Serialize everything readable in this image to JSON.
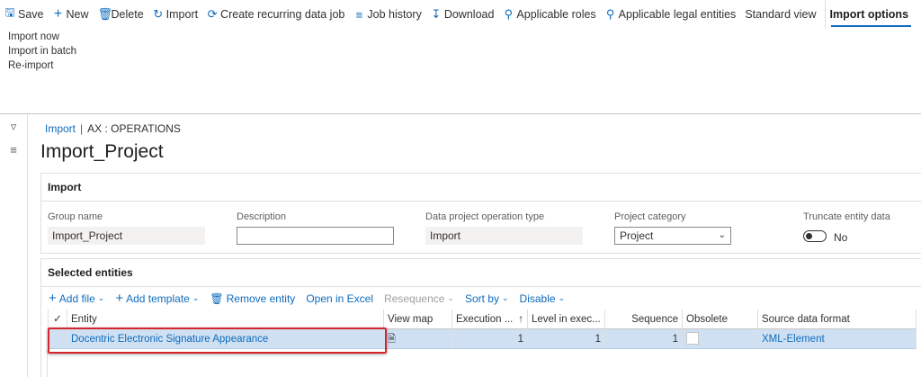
{
  "action_pane": {
    "save": "Save",
    "new": "New",
    "delete": "Delete",
    "import": "Import",
    "recurring": "Create recurring data job",
    "job_history": "Job history",
    "download": "Download",
    "roles": "Applicable roles",
    "legal_entities": "Applicable legal entities",
    "standard_view": "Standard view",
    "import_options_tab": "Import options"
  },
  "import_options_menu": [
    "Import now",
    "Import in batch",
    "Re-import"
  ],
  "breadcrumb": {
    "link": "Import",
    "separator": "|",
    "current": "AX : OPERATIONS"
  },
  "page_title": "Import_Project",
  "import_group": {
    "header": "Import",
    "group_name": {
      "label": "Group name",
      "value": "Import_Project"
    },
    "description": {
      "label": "Description",
      "value": ""
    },
    "operation_type": {
      "label": "Data project operation type",
      "value": "Import"
    },
    "project_category": {
      "label": "Project category",
      "value": "Project"
    },
    "truncate": {
      "label": "Truncate entity data",
      "value": "No"
    }
  },
  "entities_group": {
    "header": "Selected entities",
    "toolbar": {
      "add_file": "Add file",
      "add_template": "Add template",
      "remove_entity": "Remove entity",
      "open_excel": "Open in Excel",
      "resequence": "Resequence",
      "sort_by": "Sort by",
      "disable": "Disable"
    },
    "columns": [
      "Entity",
      "View map",
      "Execution ...",
      "Level in exec...",
      "Sequence",
      "Obsolete",
      "Source data format"
    ],
    "rows": [
      {
        "entity": "Docentric Electronic Signature Appearance",
        "execution": "1",
        "level": "1",
        "sequence": "1",
        "source_format": "XML-Element"
      }
    ]
  },
  "colors": {
    "accent": "#0f6cbd",
    "selected_row": "#cfe0f3",
    "highlight_border": "#d6252c"
  }
}
